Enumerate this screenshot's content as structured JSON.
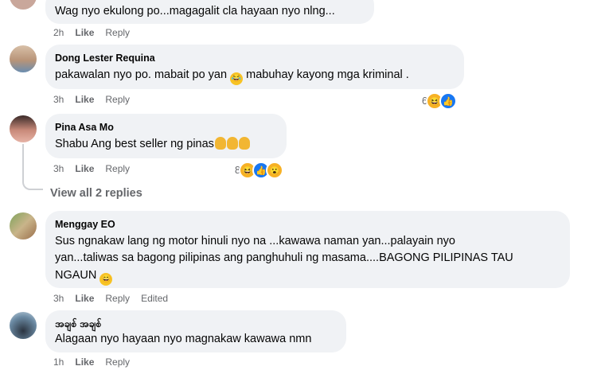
{
  "comments": [
    {
      "author": "",
      "text": "Wag nyo ekulong po...magagalit cla hayaan nyo nlng...",
      "time": "2h",
      "like": "Like",
      "reply": "Reply"
    },
    {
      "author": "Dong Lester Requina",
      "text_a": "pakawalan nyo po. mabait po yan",
      "text_b": "mabuhay kayong mga kriminal .",
      "time": "3h",
      "like": "Like",
      "reply": "Reply",
      "reaction_count": "6",
      "reactions": [
        "haha-icon",
        "like-icon"
      ]
    },
    {
      "author": "Pina Asa Mo",
      "text": "Shabu Ang best seller ng pinas",
      "time": "3h",
      "like": "Like",
      "reply": "Reply",
      "reaction_count": "8",
      "reactions": [
        "haha-icon",
        "like-icon",
        "wow-icon"
      ]
    },
    {
      "author": "Menggay EO",
      "lines": [
        "Sus ngnakaw lang ng motor hinuli nyo na ...kawawa naman yan...palayain nyo",
        "yan...taliwas sa bagong pilipinas ang panghuhuli ng masama....BAGONG PILIPINAS TAU",
        "NGAUN"
      ],
      "time": "3h",
      "like": "Like",
      "reply": "Reply",
      "edited": "Edited"
    },
    {
      "author": "အချစ် အချစ်",
      "text": "Alagaan nyo hayaan nyo magnakaw kawawa nmn",
      "time": "1h",
      "like": "Like",
      "reply": "Reply"
    }
  ],
  "view_replies": "View all 2 replies",
  "colors": {
    "bubble": "#f0f2f5",
    "meta": "#65676b",
    "like_blue": "#1877f2"
  }
}
